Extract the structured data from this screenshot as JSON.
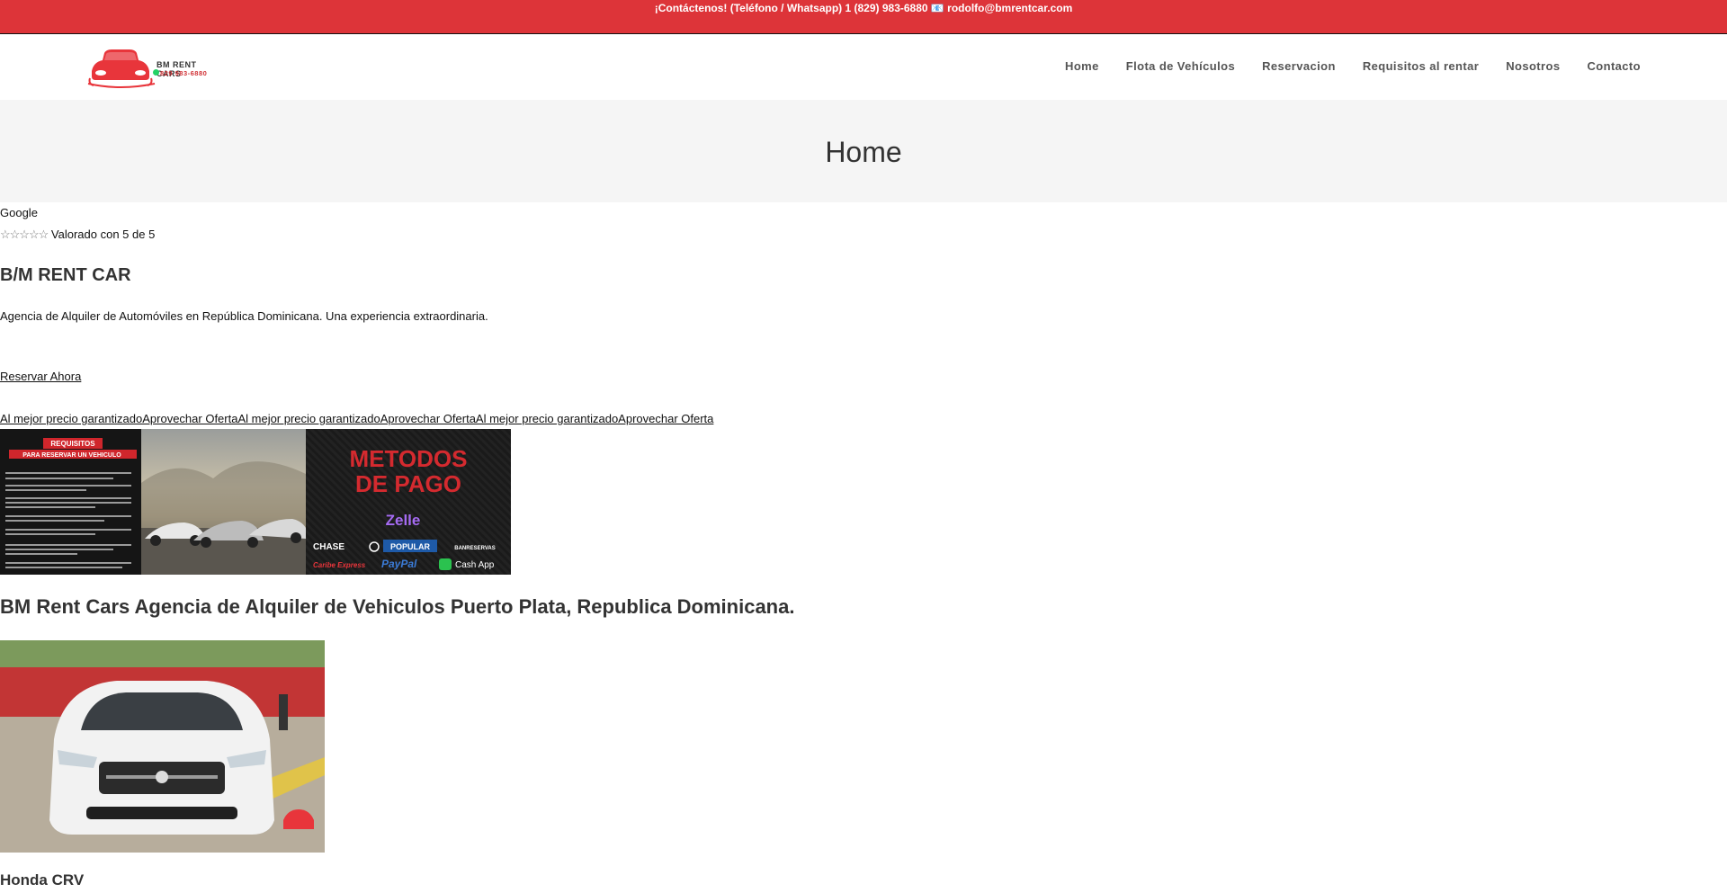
{
  "topbar": {
    "contact_text": "¡Contáctenos! (Teléfono / Whatsapp) 1 (829) 983-6880 📧 rodolfo@bmrentcar.com"
  },
  "logo": {
    "name": "BM RENT CARS",
    "phone": "829 983-6880"
  },
  "nav": {
    "items": [
      "Home",
      "Flota de Vehículos",
      "Reservacion",
      "Requisitos al rentar",
      "Nosotros",
      "Contacto"
    ]
  },
  "page": {
    "title": "Home"
  },
  "rating": {
    "source": "Google",
    "stars": "☆☆☆☆☆",
    "label": "Valorado con 5 de 5",
    "value": 5,
    "max": 5
  },
  "hero": {
    "brand": "B/M RENT CAR",
    "description": "Agencia de Alquiler de Automóviles en República Dominicana. Una experiencia extraordinaria.",
    "reserve_label": "Reservar Ahora",
    "offers_text": "Al mejor precio garantizadoAprovechar OfertaAl mejor precio garantizadoAprovechar OfertaAl mejor precio garantizadoAprovechar Oferta"
  },
  "gallery": {
    "img1_title_line1": "REQUISITOS",
    "img1_title_line2": "PARA RESERVAR UN VEHICULO",
    "img3_title_line1": "METODOS",
    "img3_title_line2": "DE PAGO",
    "payment_methods": [
      "Zelle",
      "CHASE",
      "POPULAR",
      "BANRESERVAS",
      "Caribe Express",
      "PayPal",
      "Cash App"
    ]
  },
  "section": {
    "heading": "BM Rent Cars Agencia de Alquiler de Vehiculos Puerto Plata, Republica Dominicana.",
    "car_name": "Honda CRV"
  },
  "colors": {
    "brand_red": "#dd3439",
    "title_band": "#f5f5f5"
  }
}
